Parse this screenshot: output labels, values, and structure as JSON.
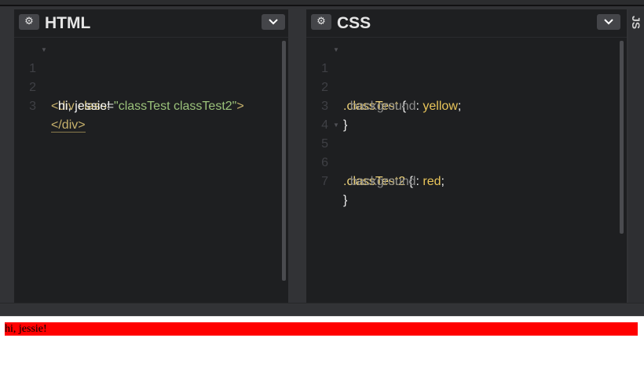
{
  "panes": {
    "html": {
      "title": "HTML",
      "lines": [
        {
          "n": "1",
          "tag_open": "<div",
          "attr": " class",
          "eq": "=",
          "str": "\"classTest classTest2\"",
          "close": ">"
        },
        {
          "n": "2",
          "text": "  hi, jessie!"
        },
        {
          "n": "3",
          "closetag": "</div>"
        }
      ]
    },
    "css": {
      "title": "CSS",
      "lines": [
        {
          "n": "1",
          "sel": ".classTest",
          "brace": " {"
        },
        {
          "n": "2",
          "prop": "  background",
          "colon": ": ",
          "val": "yellow",
          "semi": ";"
        },
        {
          "n": "3",
          "brace": "}"
        },
        {
          "n": "4"
        },
        {
          "n": "5",
          "sel": ".classTest2",
          "brace": " {"
        },
        {
          "n": "6",
          "prop": "  background",
          "colon": ": ",
          "val": "red",
          "semi": ";"
        },
        {
          "n": "7",
          "brace": "}"
        }
      ]
    },
    "js": {
      "title": "JS"
    }
  },
  "output": {
    "text": "hi, jessie!"
  },
  "icons": {
    "settings": "gear-icon",
    "collapse": "chevron-down-icon"
  }
}
